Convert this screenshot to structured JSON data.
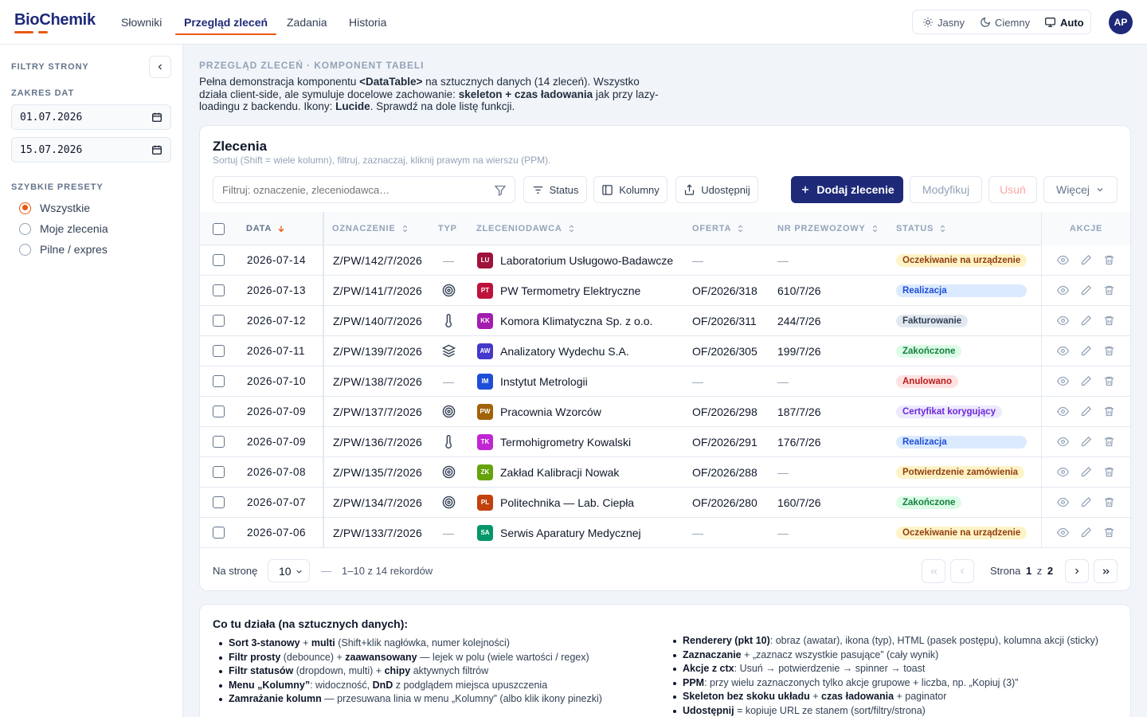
{
  "app": {
    "logo": "BioChemik"
  },
  "nav": {
    "items": [
      "Słowniki",
      "Przegląd zleceń",
      "Zadania",
      "Historia"
    ],
    "active_index": 1
  },
  "theme": {
    "light": "Jasny",
    "dark": "Ciemny",
    "auto": "Auto",
    "selected": "Auto"
  },
  "user": {
    "initials": "AP"
  },
  "sidebar": {
    "title": "FILTRY STRONY",
    "date_range_label": "ZAKRES DAT",
    "date_from": "01.07.2026",
    "date_to": "15.07.2026",
    "presets_label": "SZYBKIE PRESETY",
    "presets": [
      "Wszystkie",
      "Moje zlecenia",
      "Pilne / expres"
    ],
    "selected_preset": "Wszystkie"
  },
  "intro": {
    "label": "PRZEGLĄD ZLECEŃ · KOMPONENT TABELI",
    "p1": "Pełna demonstracja komponentu ",
    "p1b": "<DataTable>",
    "p2": " na sztucznych danych (14 zleceń). Wszystko działa client-side, ale symuluje docelowe zachowanie: ",
    "p2b": "skeleton + czas ładowania",
    "p3": " jak przy lazy-loadingu z backendu. Ikony: ",
    "p3b": "Lucide",
    "p4": ". Sprawdź na dole listę funkcji."
  },
  "table": {
    "title": "Zlecenia",
    "subtitle": "Sortuj (Shift = wiele kolumn), filtruj, zaznaczaj, kliknij prawym na wierszu (PPM).",
    "filter_placeholder": "Filtruj: oznaczenie, zleceniodawca…",
    "buttons": {
      "status": "Status",
      "columns": "Kolumny",
      "share": "Udostępnij",
      "add": "Dodaj zlecenie",
      "modify": "Modyfikuj",
      "delete": "Usuń",
      "more": "Więcej"
    },
    "columns": {
      "date": "DATA",
      "code": "OZNACZENIE",
      "type": "TYP",
      "client": "ZLECENIODAWCA",
      "offer": "OFERTA",
      "transport": "NR PRZEWOZOWY",
      "status": "STATUS",
      "actions": "AKCJE"
    },
    "rows": [
      {
        "date": "2026-07-14",
        "code": "Z/PW/142/7/2026",
        "type": "none",
        "client": "Laboratorium Usługowo-Badawcze",
        "initials": "LU",
        "avatar_color": "#9f1239",
        "offer": "—",
        "transport": "—",
        "status": "Oczekiwanie na urządzenie",
        "status_kind": "waiting"
      },
      {
        "date": "2026-07-13",
        "code": "Z/PW/141/7/2026",
        "type": "target",
        "client": "PW Termometry Elektryczne",
        "initials": "PT",
        "avatar_color": "#be123c",
        "offer": "OF/2026/318",
        "transport": "610/7/26",
        "status": "Realizacja",
        "status_kind": "progress"
      },
      {
        "date": "2026-07-12",
        "code": "Z/PW/140/7/2026",
        "type": "thermometer",
        "client": "Komora Klimatyczna Sp. z o.o.",
        "initials": "KK",
        "avatar_color": "#a21caf",
        "offer": "OF/2026/311",
        "transport": "244/7/26",
        "status": "Fakturowanie",
        "status_kind": "billing"
      },
      {
        "date": "2026-07-11",
        "code": "Z/PW/139/7/2026",
        "type": "layers",
        "client": "Analizatory Wydechu S.A.",
        "initials": "AW",
        "avatar_color": "#4338ca",
        "offer": "OF/2026/305",
        "transport": "199/7/26",
        "status": "Zakończone",
        "status_kind": "done"
      },
      {
        "date": "2026-07-10",
        "code": "Z/PW/138/7/2026",
        "type": "none",
        "client": "Instytut Metrologii",
        "initials": "IM",
        "avatar_color": "#1d4ed8",
        "offer": "—",
        "transport": "—",
        "status": "Anulowano",
        "status_kind": "cancel"
      },
      {
        "date": "2026-07-09",
        "code": "Z/PW/137/7/2026",
        "type": "target",
        "client": "Pracownia Wzorców",
        "initials": "PW",
        "avatar_color": "#a16207",
        "offer": "OF/2026/298",
        "transport": "187/7/26",
        "status": "Certyfikat korygujący",
        "status_kind": "cert"
      },
      {
        "date": "2026-07-09",
        "code": "Z/PW/136/7/2026",
        "type": "thermometer",
        "client": "Termohigrometry Kowalski",
        "initials": "TK",
        "avatar_color": "#c026d3",
        "offer": "OF/2026/291",
        "transport": "176/7/26",
        "status": "Realizacja",
        "status_kind": "progress"
      },
      {
        "date": "2026-07-08",
        "code": "Z/PW/135/7/2026",
        "type": "target",
        "client": "Zakład Kalibracji Nowak",
        "initials": "ZK",
        "avatar_color": "#65a30d",
        "offer": "OF/2026/288",
        "transport": "—",
        "status": "Potwierdzenie zamówienia",
        "status_kind": "confirm"
      },
      {
        "date": "2026-07-07",
        "code": "Z/PW/134/7/2026",
        "type": "target",
        "client": "Politechnika — Lab. Ciepła",
        "initials": "PL",
        "avatar_color": "#c2410c",
        "offer": "OF/2026/280",
        "transport": "160/7/26",
        "status": "Zakończone",
        "status_kind": "done"
      },
      {
        "date": "2026-07-06",
        "code": "Z/PW/133/7/2026",
        "type": "none",
        "client": "Serwis Aparatury Medycznej",
        "initials": "SA",
        "avatar_color": "#059669",
        "offer": "—",
        "transport": "—",
        "status": "Oczekiwanie na urządzenie",
        "status_kind": "waiting"
      }
    ],
    "status_colors": {
      "waiting": {
        "bg": "#fef3c7",
        "fg": "#92400e"
      },
      "progress": {
        "bg": "#dbeafe",
        "fg": "#1d4ed8"
      },
      "billing": {
        "bg": "#e2e8f0",
        "fg": "#334155"
      },
      "done": {
        "bg": "#dcfce7",
        "fg": "#15803d"
      },
      "cancel": {
        "bg": "#fee2e2",
        "fg": "#b91c1c"
      },
      "cert": {
        "bg": "#ede9fe",
        "fg": "#6d28d9"
      },
      "confirm": {
        "bg": "#fef3c7",
        "fg": "#92400e"
      }
    },
    "footer": {
      "per_page_label": "Na stronę",
      "per_page": "10",
      "sep": "—",
      "range": "1–10 z 14 rekordów",
      "page_label": "Strona",
      "page": "1",
      "of": "z",
      "pages": "2"
    }
  },
  "features": {
    "title": "Co tu działa (na sztucznych danych):",
    "left": [
      [
        [
          "b",
          "Sort 3-stanowy"
        ],
        [
          "t",
          " + "
        ],
        [
          "b",
          "multi"
        ],
        [
          "t",
          " (Shift+klik nagłówka, numer kolejności)"
        ]
      ],
      [
        [
          "b",
          "Filtr prosty"
        ],
        [
          "t",
          " (debounce) + "
        ],
        [
          "b",
          "zaawansowany"
        ],
        [
          "t",
          " — lejek w polu (wiele wartości / regex)"
        ]
      ],
      [
        [
          "b",
          "Filtr statusów"
        ],
        [
          "t",
          " (dropdown, multi) + "
        ],
        [
          "b",
          "chipy"
        ],
        [
          "t",
          " aktywnych filtrów"
        ]
      ],
      [
        [
          "b",
          "Menu „Kolumny”"
        ],
        [
          "t",
          ": widoczność, "
        ],
        [
          "b",
          "DnD"
        ],
        [
          "t",
          " z podglądem miejsca upuszczenia"
        ]
      ],
      [
        [
          "b",
          "Zamrażanie kolumn"
        ],
        [
          "t",
          " — przesuwana linia w menu „Kolumny” (albo klik ikony pinezki)"
        ]
      ]
    ],
    "right": [
      [
        [
          "b",
          "Renderery (pkt 10)"
        ],
        [
          "t",
          ": obraz (awatar), ikona (typ), HTML (pasek postępu), kolumna akcji (sticky)"
        ]
      ],
      [
        [
          "b",
          "Zaznaczanie"
        ],
        [
          "t",
          " + „zaznacz wszystkie pasujące” (cały wynik)"
        ]
      ],
      [
        [
          "b",
          "Akcje z ctx"
        ],
        [
          "t",
          ": Usuń → potwierdzenie → spinner → toast"
        ]
      ],
      [
        [
          "b",
          "PPM"
        ],
        [
          "t",
          ": przy wielu zaznaczonych tylko akcje grupowe + liczba, np. „Kopiuj (3)”"
        ]
      ],
      [
        [
          "b",
          "Skeleton bez skoku układu"
        ],
        [
          "t",
          " + "
        ],
        [
          "b",
          "czas ładowania"
        ],
        [
          "t",
          " + paginator"
        ]
      ],
      [
        [
          "b",
          "Udostępnij"
        ],
        [
          "t",
          " = kopiuje URL ze stanem (sort/filtry/strona)"
        ]
      ]
    ]
  }
}
